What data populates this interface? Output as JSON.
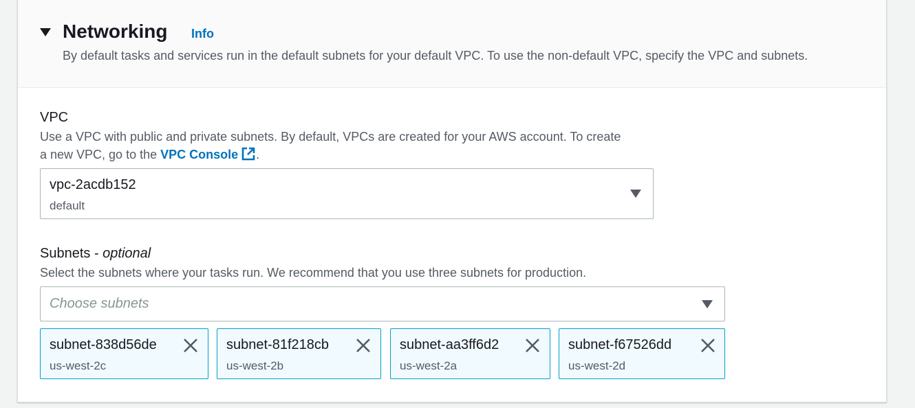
{
  "section": {
    "title": "Networking",
    "info_label": "Info",
    "description": "By default tasks and services run in the default subnets for your default VPC. To use the non-default VPC, specify the VPC and subnets."
  },
  "vpc": {
    "label": "VPC",
    "description_line1": "Use a VPC with public and private subnets. By default, VPCs are created for your AWS account. To create",
    "description_line2_prefix": "a new VPC, go to the",
    "console_link": "VPC Console",
    "description_line2_suffix": ".",
    "selected_value": "vpc-2acdb152",
    "selected_tag": "default"
  },
  "subnets": {
    "label": "Subnets -",
    "label_optional": "optional",
    "description": "Select the subnets where your tasks run. We recommend that you use three subnets for production.",
    "placeholder": "Choose subnets",
    "tokens": [
      {
        "name": "subnet-838d56de",
        "zone": "us-west-2c"
      },
      {
        "name": "subnet-81f218cb",
        "zone": "us-west-2b"
      },
      {
        "name": "subnet-aa3ff6d2",
        "zone": "us-west-2a"
      },
      {
        "name": "subnet-f67526dd",
        "zone": "us-west-2d"
      }
    ]
  },
  "colors": {
    "link": "#0073bb",
    "token_border": "#00a1c9",
    "token_bg": "#f1faff"
  }
}
